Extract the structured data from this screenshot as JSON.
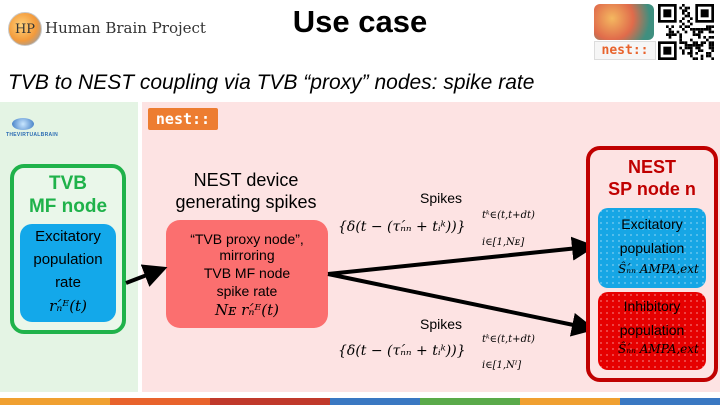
{
  "header": {
    "org_logo_text": "HP",
    "org_name": "Human Brain Project",
    "title": "Use case",
    "nest_logo": "nest::"
  },
  "subtitle": "TVB to NEST coupling via TVB “proxy” nodes: spike rate",
  "tvb_panel": {
    "logo_text": "THEVIRTUALBRAIN",
    "node_title_line1": "TVB",
    "node_title_line2": "MF node",
    "rate_lines": [
      "Excitatory",
      "population",
      "rate"
    ],
    "rate_symbol": "rₙ́ᴱ(t)"
  },
  "nest_panel": {
    "logo": "nest::",
    "device_title_line1": "NEST device",
    "device_title_line2": "generating spikes",
    "proxy_lines": [
      "“TVB proxy node”,",
      "mirroring",
      "TVB MF node",
      "spike rate"
    ],
    "proxy_symbol": "Nᴇ rₙ́ᴱ(t)",
    "spikes_label_top": "Spikes",
    "spikes_label_bottom": "Spikes",
    "formula_top": "{δ(t − (τₙ́ₙ + tᵢᵏ))}",
    "formula_top_sup": "tᵏ∈(t,t+dt)",
    "formula_top_sub": "i∈[1,Nᴇ]",
    "formula_bottom": "{δ(t − (τₙ́ₙ + tᵢᵏ))}",
    "formula_bottom_sup": "tᵏ∈(t,t+dt)",
    "formula_bottom_sub": "i∈[1,Nᴵ]"
  },
  "sp_node": {
    "title_line1": "NEST",
    "title_line2": "SP node n",
    "excitatory_lines": [
      "Excitatory",
      "population"
    ],
    "excitatory_symbol": "Ŝₙ́ₙ AMPA,ext",
    "inhibitory_lines": [
      "Inhibitory",
      "population"
    ],
    "inhibitory_symbol": "Ŝₙ́ₙ AMPA,ext"
  },
  "colors": {
    "tvb_green": "#1fb24a",
    "nest_red": "#c00000",
    "nest_orange": "#ed7d31",
    "excitatory_blue": "#16a6e5",
    "inhibitory_red": "#e60000",
    "proxy_red": "#fb6f6f"
  },
  "icons": [
    "hbp-logo-icon",
    "brain-icon",
    "qr-code-icon",
    "tvb-brain-icon"
  ]
}
